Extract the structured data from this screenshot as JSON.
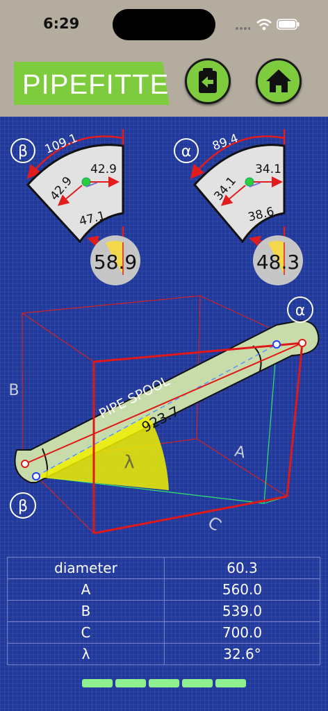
{
  "status_bar": {
    "time": "6:29"
  },
  "header": {
    "app_title": "PIPEFITTER",
    "back_icon": "clipboard-back-arrow-icon",
    "home_icon": "home-icon",
    "accent_color": "#7ecb3e"
  },
  "gauges": {
    "beta": {
      "symbol": "β",
      "arc_value": "109.1",
      "left_value": "42.9",
      "right_value": "42.9",
      "bottom_value": "47.1",
      "dial_value": "58.9"
    },
    "alpha": {
      "symbol": "α",
      "arc_value": "89.4",
      "left_value": "34.1",
      "right_value": "34.1",
      "bottom_value": "38.6",
      "dial_value": "48.3"
    }
  },
  "diagram": {
    "pipe_label": "PIPE SPOOL",
    "pipe_length": "923.7",
    "label_a": "A",
    "label_b": "B",
    "label_c": "C",
    "label_lambda": "λ",
    "end_alpha": "α",
    "end_beta": "β"
  },
  "table": {
    "rows": [
      {
        "key": "diameter",
        "value": "60.3"
      },
      {
        "key": "A",
        "value": "560.0"
      },
      {
        "key": "B",
        "value": "539.0"
      },
      {
        "key": "C",
        "value": "700.0"
      },
      {
        "key": "λ",
        "value": "32.6°"
      }
    ]
  },
  "pager": {
    "segments": 5
  }
}
